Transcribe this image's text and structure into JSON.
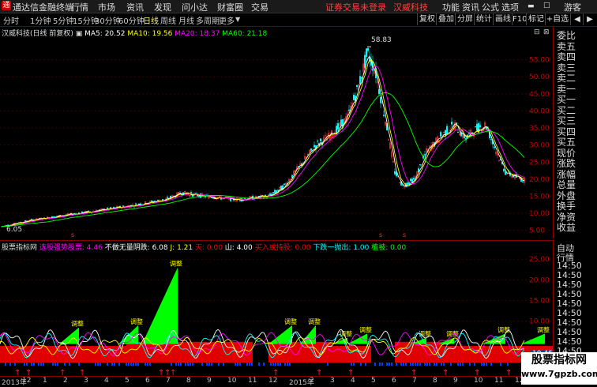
{
  "menubar": {
    "app_name": "通达信金融终端",
    "items": [
      "行情",
      "市场",
      "资讯",
      "发现",
      "问小达",
      "财富圈",
      "交易"
    ],
    "alert": "证券交易未登录",
    "stock_name": "汉威科技",
    "right_items": [
      "功能",
      "资讯",
      "公式",
      "选项"
    ],
    "guest": "游客"
  },
  "tabbar": {
    "periods": [
      "分时",
      "1分钟",
      "5分钟",
      "15分钟",
      "30分钟",
      "60分钟",
      "日线",
      "周线",
      "月线",
      "多周期",
      "更多"
    ],
    "active": "日线",
    "buttons": [
      "复权",
      "叠加",
      "分屏",
      "统计",
      "画线",
      "F10",
      "标记",
      "+自选"
    ]
  },
  "main_chart": {
    "title": "汉威科技(日线 前复权)",
    "ma": [
      {
        "label": "MA5: 20.52",
        "color": "#ffffff"
      },
      {
        "label": "MA10: 19.56",
        "color": "#ffff00"
      },
      {
        "label": "MA20: 18.37",
        "color": "#ff00ff"
      },
      {
        "label": "MA60: 21.18",
        "color": "#00ff00"
      }
    ],
    "high_label": "58.83",
    "low_label": "6.05",
    "y_ticks": [
      "55.00",
      "50.00",
      "45.00",
      "40.00",
      "35.00",
      "30.00",
      "25.00",
      "20.00",
      "15.00",
      "10.00",
      "5.00"
    ]
  },
  "side": {
    "items": [
      "委比",
      "卖五",
      "卖四",
      "卖三",
      "卖二",
      "卖一",
      "买一",
      "买二",
      "买三",
      "买四",
      "买五",
      "现价",
      "涨跌",
      "涨幅",
      "总量",
      "外盘",
      "换手",
      "净资",
      "收益"
    ]
  },
  "side2": {
    "items": [
      "自动",
      "行情",
      "14:50",
      "14:50",
      "14:50",
      "14:50",
      "14:50",
      "14:50",
      "14:50",
      "14:50",
      "14:50",
      "14:50",
      "14:50",
      "14:50"
    ]
  },
  "indicator": {
    "name": "股票指标网",
    "items": [
      {
        "label": "选股强势股票: 4.46",
        "color": "#ff00ff"
      },
      {
        "label": "不做无量阴跌: 6.08",
        "color": "#ffffff"
      },
      {
        "label": "J: 1.21",
        "color": "#ffff00"
      },
      {
        "label": "天: 0.00",
        "color": "#ff0000"
      },
      {
        "label": "山: 4.00",
        "color": "#ffffff"
      },
      {
        "label": "买入或持股: 0.00",
        "color": "#ff0000"
      },
      {
        "label": "下跌一抛出: 1.00",
        "color": "#00ffff"
      },
      {
        "label": "植被: 0.00",
        "color": "#00ff00"
      }
    ],
    "y_ticks": [
      "25.00",
      "20.00",
      "15.00",
      "10.00",
      "5.00"
    ],
    "value_box": "10.46",
    "tag_label": "调整"
  },
  "date_axis": {
    "labels": [
      "2013年",
      "12",
      "1",
      "2",
      "3",
      "4",
      "5",
      "6",
      "7",
      "8",
      "9",
      "10",
      "11",
      "12",
      "2015年",
      "2",
      "3",
      "4",
      "5",
      "6",
      "7",
      "8",
      "9",
      "10",
      "11",
      "12"
    ]
  },
  "watermark": {
    "line1": "股票指标网",
    "line2": "www.7gpzb.com"
  }
}
